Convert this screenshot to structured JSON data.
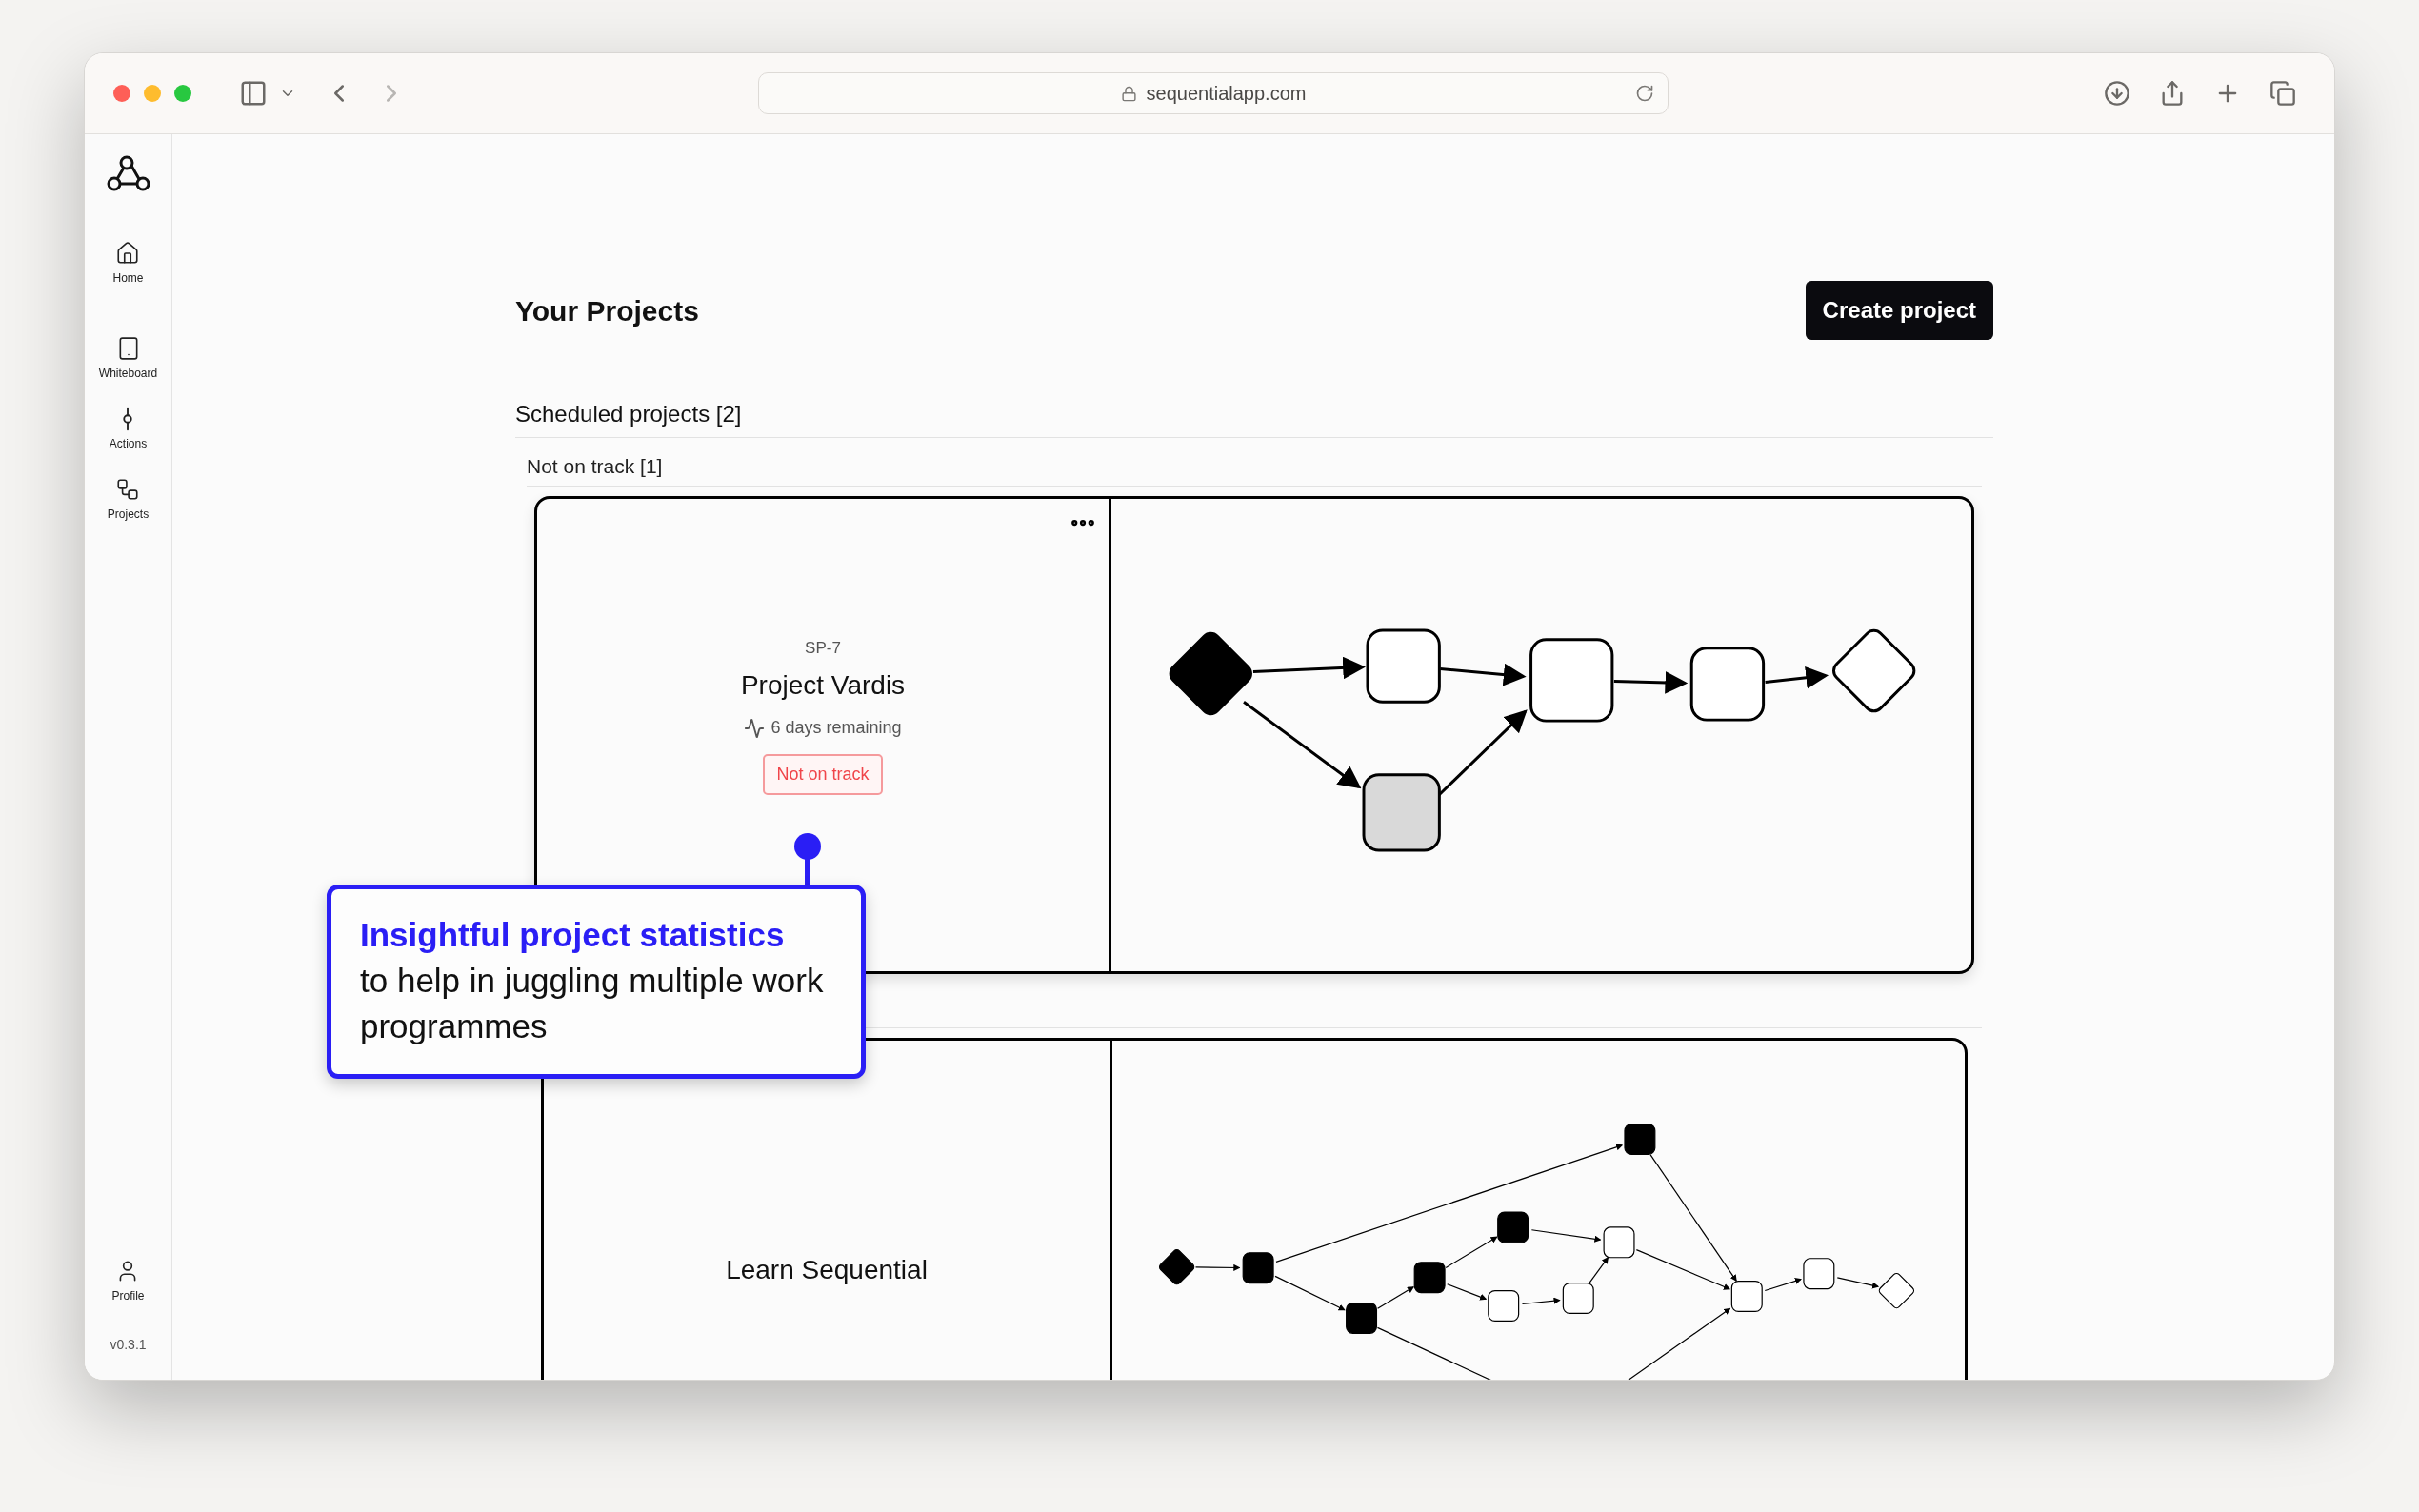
{
  "browser": {
    "url": "sequentialapp.com"
  },
  "sidebar": {
    "items": [
      {
        "kind": "home",
        "label": "Home"
      },
      {
        "kind": "whiteboard",
        "label": "Whiteboard"
      },
      {
        "kind": "actions",
        "label": "Actions"
      },
      {
        "kind": "projects",
        "label": "Projects"
      }
    ],
    "profile": "Profile",
    "version": "v0.3.1"
  },
  "page": {
    "title": "Your Projects",
    "create_button": "Create project"
  },
  "section": {
    "title": "Scheduled projects [2]",
    "group": "Not on track [1]"
  },
  "projects": [
    {
      "key": "SP-7",
      "name": "Project Vardis",
      "remaining": "6 days remaining",
      "status": "Not on track",
      "kind": "simple"
    },
    {
      "name": "Learn Sequential",
      "kind": "complex"
    }
  ],
  "callout": {
    "text": "**Insightful project statistics** to help in juggling multiple work programmes"
  }
}
